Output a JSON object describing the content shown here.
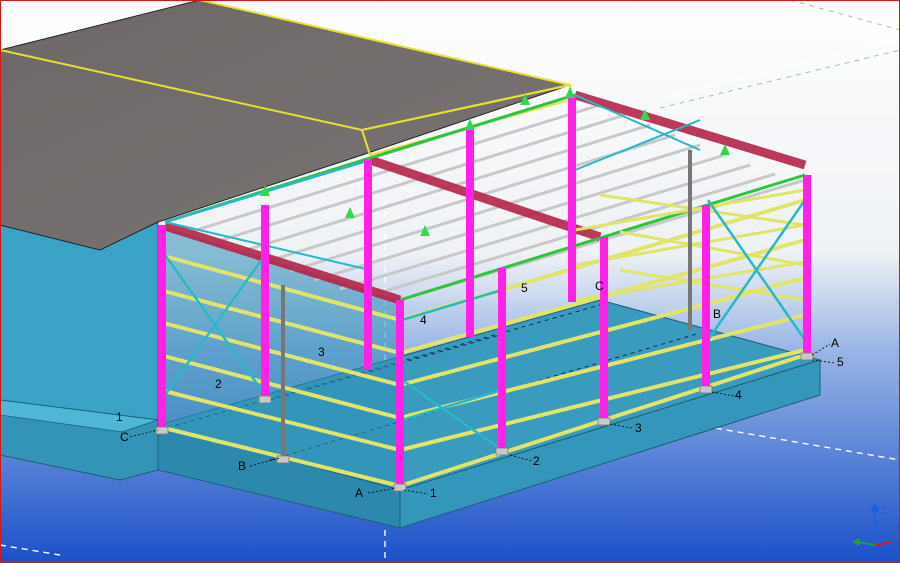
{
  "viewport": {
    "name": "3D structural model view",
    "border_color": "#d01818",
    "background_top": "#f4f6f8",
    "background_bottom": "#1a50c8"
  },
  "colors": {
    "roof_panel": "#6e6a69",
    "wall_panel": "#3fa7c9",
    "slab": "#3b9ac0",
    "column": "#ff22e6",
    "girt": "#e3e86a",
    "purlin": "#bfbfbf",
    "rafter": "#b02244",
    "eave": "#27c43c",
    "bracing": "#27b8c8",
    "ridge": "#ffff33",
    "grid_line": "#ffffff"
  },
  "grid_labels": {
    "rows": [
      "A",
      "B",
      "C"
    ],
    "columns": [
      "1",
      "2",
      "3",
      "4",
      "5"
    ],
    "front_numbers": [
      "1",
      "2",
      "3",
      "4"
    ],
    "left_numbers": [
      "1",
      "2",
      "3",
      "4",
      "5"
    ],
    "back_letters": [
      "B",
      "C"
    ],
    "front_row_A": "A",
    "front_row_B": "B",
    "front_row_C": "C",
    "right_A": "A",
    "right_5": "5"
  },
  "axis_gizmo": {
    "z_label": "Z",
    "y_label": "Y",
    "x_label": "X"
  }
}
